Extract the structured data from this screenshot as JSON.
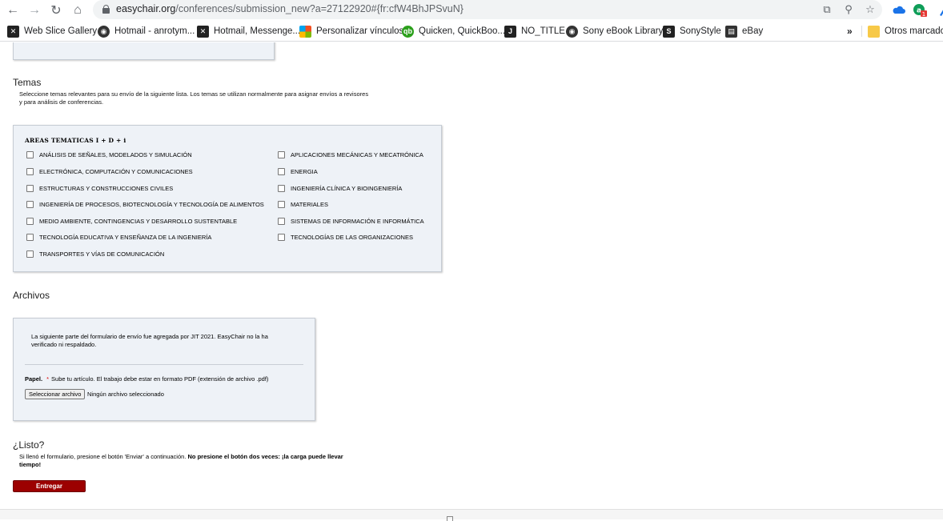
{
  "browser": {
    "url_host": "easychair.org",
    "url_path": "/conferences/submission_new?a=27122920#{fr:cfW4BhJPSvuN}",
    "extension_badge": "1"
  },
  "bookmarks": [
    {
      "label": "Web Slice Gallery",
      "icon": "web-slice-icon"
    },
    {
      "label": "Hotmail - anrotym...",
      "icon": "globe-icon"
    },
    {
      "label": "Hotmail, Messenge...",
      "icon": "web-slice-icon"
    },
    {
      "label": "Personalizar vínculos",
      "icon": "microsoft-icon"
    },
    {
      "label": "Quicken, QuickBoo...",
      "icon": "quickbooks-icon"
    },
    {
      "label": "NO_TITLE",
      "icon": "j-icon"
    },
    {
      "label": "Sony eBook Library",
      "icon": "globe-icon"
    },
    {
      "label": "SonyStyle",
      "icon": "s-icon"
    },
    {
      "label": "eBay",
      "icon": "bag-icon"
    }
  ],
  "bookmarks_more": "»",
  "other_bookmarks": "Otros marcadore",
  "topics": {
    "title": "Temas",
    "description_line1": "Seleccione temas relevantes para su envío de la siguiente lista. Los temas se utilizan normalmente para asignar envíos a revisores",
    "description_line2": "y para análisis de conferencias.",
    "group_title": "AREAS TEMATICAS I + D + i",
    "left": [
      "ANÁLISIS DE SEÑALES, MODELADOS Y SIMULACIÓN",
      "ELECTRÓNICA, COMPUTACIÓN Y COMUNICACIONES",
      "ESTRUCTURAS Y CONSTRUCCIONES CIVILES",
      "INGENIERÍA DE PROCESOS, BIOTECNOLOGÍA Y TECNOLOGÍA DE ALIMENTOS",
      "MEDIO AMBIENTE, CONTINGENCIAS Y DESARROLLO SUSTENTABLE",
      "TECNOLOGÍA EDUCATIVA Y ENSEÑANZA DE LA INGENIERÍA",
      "TRANSPORTES Y VÍAS DE COMUNICACIÓN"
    ],
    "right": [
      "APLICACIONES MECÁNICAS Y MECATRÓNICA",
      "ENERGIA",
      "INGENIERÍA CLÍNICA Y BIOINGENIERÍA",
      "MATERIALES",
      "SISTEMAS DE INFORMACIÓN E INFORMÁTICA",
      "TECNOLOGÍAS DE LAS ORGANIZACIONES"
    ]
  },
  "files": {
    "title": "Archivos",
    "note_line1": "La siguiente parte del formulario de envío fue agregada por JIT 2021. EasyChair no la ha",
    "note_line2": "verificado ni respaldado.",
    "paper_label": "Papel.",
    "required_mark": "*",
    "paper_instructions": "Sube tu artículo. El trabajo debe estar en formato PDF (extensión de archivo .pdf)",
    "choose_button": "Seleccionar archivo",
    "no_file": "Ningún archivo seleccionado"
  },
  "ready": {
    "title": "¿Listo?",
    "text_normal": "Si llenó el formulario, presione el botón 'Enviar' a continuación. ",
    "text_bold_1": "No presione el botón dos veces: ¡la carga puede llevar",
    "text_bold_2": "tiempo!",
    "submit_label": "Entregar"
  }
}
